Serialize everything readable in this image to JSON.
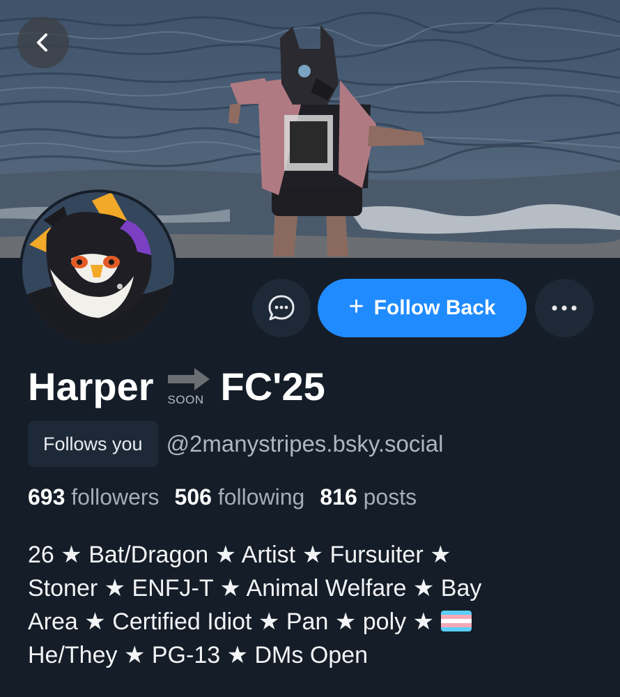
{
  "header": {
    "back_icon": "chevron-left-icon"
  },
  "actions": {
    "message_icon": "chat-bubble-icon",
    "follow_plus": "+",
    "follow_label": "Follow Back",
    "more_icon": "ellipsis-icon"
  },
  "profile": {
    "display_name_part1": "Harper",
    "emoji_label": "SOON",
    "display_name_part2": "FC'25",
    "follows_you_badge": "Follows you",
    "handle": "@2manystripes.bsky.social"
  },
  "stats": {
    "followers_count": "693",
    "followers_label": "followers",
    "following_count": "506",
    "following_label": "following",
    "posts_count": "816",
    "posts_label": "posts"
  },
  "bio": {
    "line1": "26 ★ Bat/Dragon ★ Artist ★ Fursuiter ★",
    "line2": "Stoner ★ ENFJ-T ★ Animal Welfare ★ Bay",
    "line3": "Area ★ Certified Idiot ★ Pan ★ poly ★",
    "line3_flag": "transgender-flag-icon",
    "line4": "He/They ★ PG-13 ★ DMs Open"
  },
  "colors": {
    "background": "#151d28",
    "accent_blue": "#208bfe",
    "button_dark": "#1e2937",
    "secondary_text": "#a5adb7"
  }
}
